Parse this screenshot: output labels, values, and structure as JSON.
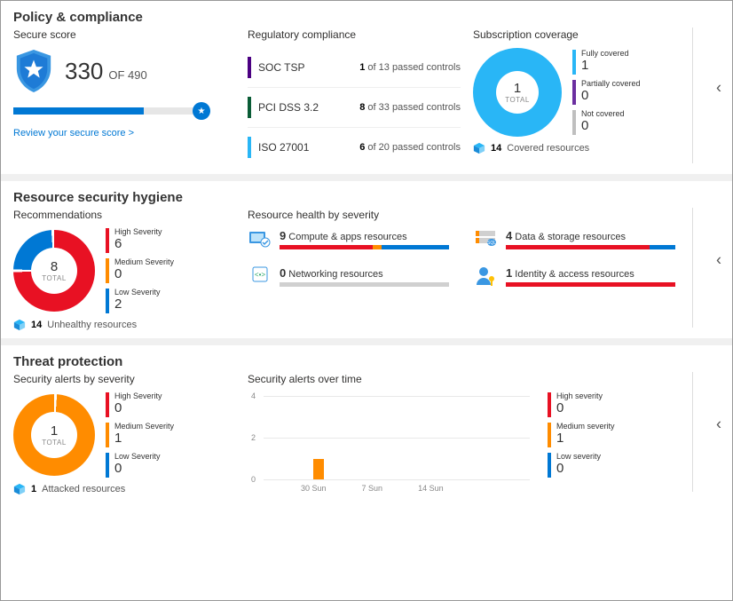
{
  "policy": {
    "title": "Policy & compliance",
    "secure_score": {
      "title": "Secure score",
      "value": "330",
      "of": "OF 490",
      "percent": 67,
      "link": "Review your secure score >"
    },
    "regulatory": {
      "title": "Regulatory compliance",
      "items": [
        {
          "color": "#4b0082",
          "name": "SOC TSP",
          "passed": "1",
          "total": "13"
        },
        {
          "color": "#0a5c36",
          "name": "PCI DSS 3.2",
          "passed": "8",
          "total": "33"
        },
        {
          "color": "#29b6f6",
          "name": "ISO 27001",
          "passed": "6",
          "total": "20"
        }
      ]
    },
    "subscription": {
      "title": "Subscription coverage",
      "center_num": "1",
      "center_lbl": "TOTAL",
      "legend": [
        {
          "color": "#29b6f6",
          "label": "Fully covered",
          "value": "1"
        },
        {
          "color": "#6b2fa0",
          "label": "Partially covered",
          "value": "0"
        },
        {
          "color": "#bfbfbf",
          "label": "Not covered",
          "value": "0"
        }
      ],
      "footer_num": "14",
      "footer_lbl": "Covered resources"
    }
  },
  "hygiene": {
    "title": "Resource security hygiene",
    "recs": {
      "title": "Recommendations",
      "center_num": "8",
      "center_lbl": "TOTAL",
      "legend": [
        {
          "color": "#e81123",
          "label": "High Severity",
          "value": "6"
        },
        {
          "color": "#ff8c00",
          "label": "Medium Severity",
          "value": "0"
        },
        {
          "color": "#0078d4",
          "label": "Low Severity",
          "value": "2"
        }
      ],
      "footer_num": "14",
      "footer_lbl": "Unhealthy resources"
    },
    "health": {
      "title": "Resource health by severity",
      "items": [
        {
          "icon": "compute",
          "count": "9",
          "label": "Compute & apps resources",
          "bars": [
            {
              "c": "#e81123",
              "p": 55
            },
            {
              "c": "#ff8c00",
              "p": 5
            },
            {
              "c": "#0078d4",
              "p": 40
            }
          ]
        },
        {
          "icon": "data",
          "count": "4",
          "label": "Data & storage resources",
          "bars": [
            {
              "c": "#e81123",
              "p": 85
            },
            {
              "c": "#0078d4",
              "p": 15
            }
          ]
        },
        {
          "icon": "network",
          "count": "0",
          "label": "Networking resources",
          "bars": [
            {
              "c": "#d0d0d0",
              "p": 100
            }
          ]
        },
        {
          "icon": "identity",
          "count": "1",
          "label": "Identity & access resources",
          "bars": [
            {
              "c": "#e81123",
              "p": 100
            }
          ]
        }
      ]
    }
  },
  "threat": {
    "title": "Threat protection",
    "alerts": {
      "title": "Security alerts by severity",
      "center_num": "1",
      "center_lbl": "TOTAL",
      "legend": [
        {
          "color": "#e81123",
          "label": "High Severity",
          "value": "0"
        },
        {
          "color": "#ff8c00",
          "label": "Medium Severity",
          "value": "1"
        },
        {
          "color": "#0078d4",
          "label": "Low Severity",
          "value": "0"
        }
      ],
      "footer_num": "1",
      "footer_lbl": "Attacked resources"
    },
    "overtime": {
      "title": "Security alerts over time",
      "legend": [
        {
          "color": "#e81123",
          "label": "High severity",
          "value": "0"
        },
        {
          "color": "#ff8c00",
          "label": "Medium severity",
          "value": "1"
        },
        {
          "color": "#0078d4",
          "label": "Low severity",
          "value": "0"
        }
      ]
    }
  },
  "chart_data": {
    "type": "bar",
    "title": "Security alerts over time",
    "ylabel": "",
    "ylim": [
      0,
      4
    ],
    "yticks": [
      0,
      2,
      4
    ],
    "xticks": [
      "30 Sun",
      "7 Sun",
      "14 Sun"
    ],
    "series": [
      {
        "name": "Medium severity",
        "color": "#ff8c00",
        "values": [
          0,
          0,
          0,
          1,
          0,
          0,
          0,
          0,
          0,
          0,
          0,
          0,
          0,
          0,
          0,
          0
        ]
      }
    ]
  }
}
